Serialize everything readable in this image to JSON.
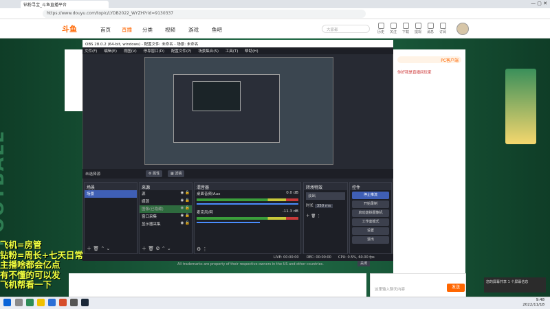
{
  "browser": {
    "tab_title": "钻粉寻宝_斗鱼直播平台",
    "url": "https://www.douyu.com/topic/LYDB2022_WYZH?rid=9130337",
    "window_controls": "— ▢ ✕"
  },
  "douyu": {
    "logo": "斗鱼",
    "nav": [
      "首页",
      "直播",
      "分类",
      "视频",
      "游戏",
      "鱼吧"
    ],
    "search_placeholder": "大家都",
    "header_icons": [
      "历史",
      "关注",
      "下载",
      "提现",
      "消息",
      "订阅"
    ],
    "pc_badge": "PC客户端",
    "chat_send_label": "发送",
    "chat_input_placeholder": "这里输入聊天内容",
    "side_panel_title": "你好我是直播间玩家",
    "overlay_lines": [
      "飞机=房管",
      "钻粉=周长+七天日常",
      "主播啥都会亿点",
      "有不懂的可以发",
      "飞机帮看一下"
    ],
    "background_text": "FOOTBALL"
  },
  "obs": {
    "title": "OBS 28.0.2 (64-bit, windows) - 配置文件: 未命名 - 场景: 未命名",
    "menu": [
      "文件(F)",
      "编辑(E)",
      "视图(V)",
      "停靠窗口(D)",
      "配置文件(P)",
      "场景集合(S)",
      "工具(T)",
      "帮助(H)"
    ],
    "no_source": "未选择源",
    "source_buttons": [
      "属性",
      "滤镜"
    ],
    "docks": {
      "scenes": {
        "title": "场景",
        "items": [
          "场景"
        ]
      },
      "sources": {
        "title": "来源",
        "items": [
          "源",
          "媒源",
          "图像(已隐藏)",
          "窗口采集",
          "显示器采集"
        ]
      },
      "mixer": {
        "title": "混音器",
        "tracks": [
          {
            "name": "桌面音频/Aux",
            "db": "0.0 dB"
          },
          {
            "name": "麦克风/阿",
            "db": "-11.3 dB"
          }
        ]
      },
      "transitions": {
        "title": "转场特效",
        "type": "淡出",
        "duration_label": "时长",
        "duration_value": "350 ms"
      },
      "controls": {
        "title": "控件",
        "buttons": [
          "停止推流",
          "开始录制",
          "启动虚拟摄像机",
          "工作室模式",
          "设置",
          "退出"
        ]
      }
    },
    "status": {
      "live": "LIVE: 00:00:00",
      "rec": "REC: 00:00:00",
      "cpu": "CPU: 0.5%, 60.00 fps"
    },
    "notice": "All trademarks are property of their respective owners in the US and other countries.",
    "close_label": "关闭"
  },
  "taskbar": {
    "time": "9:48",
    "date": "2022/11/18"
  },
  "toast": {
    "text": "您的屏幕共享 1 个屏幕信息"
  },
  "colors": {
    "obs_bg": "#272a33",
    "obs_accent": "#3f5fb5",
    "douyu_orange": "#ff6600",
    "overlay_text": "#f0ff40"
  }
}
